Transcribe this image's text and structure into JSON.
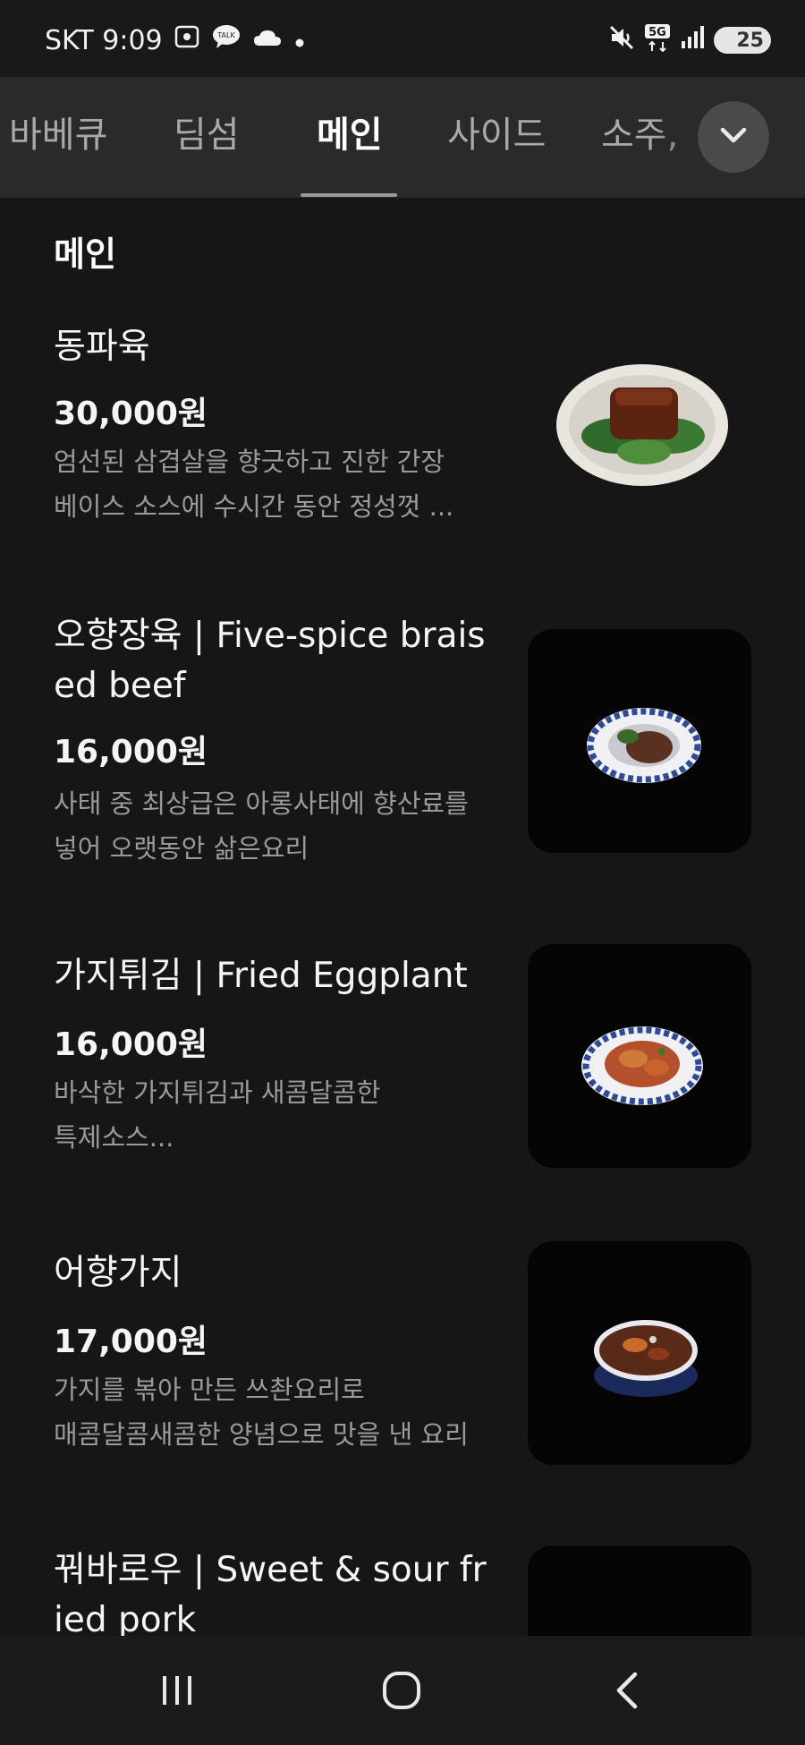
{
  "status": {
    "carrier_time": "SKT 9:09",
    "network": "5G",
    "battery": "25",
    "icons": [
      "screen-capture-icon",
      "talk-icon",
      "cloud-icon",
      "dot-icon",
      "mute-icon",
      "5g-icon",
      "signal-icon",
      "battery-icon"
    ]
  },
  "tabs": [
    {
      "label": "바베큐",
      "active": false
    },
    {
      "label": "딤섬",
      "active": false
    },
    {
      "label": "메인",
      "active": true
    },
    {
      "label": "사이드",
      "active": false
    },
    {
      "label": "소주,",
      "active": false
    }
  ],
  "section": {
    "title": "메인"
  },
  "items": [
    {
      "name": "동파육",
      "price": "30,000원",
      "desc_lines": [
        "엄선된 삼겹살을 향긋하고 진한 간장",
        "베이스 소스에 수시간 동안 정성껏 ..."
      ]
    },
    {
      "name": "오향장육 | Five-spice braised beef",
      "price": "16,000원",
      "desc_lines": [
        "사태 중 최상급은 아롱사태에 향산료를",
        "넣어 오랫동안 삶은요리"
      ]
    },
    {
      "name": "가지튀김 | Fried Eggplant",
      "price": "16,000원",
      "desc_lines": [
        "바삭한 가지튀김과 새콤달콤한",
        "특제소스..."
      ]
    },
    {
      "name": "어향가지",
      "price": "17,000원",
      "desc_lines": [
        "가지를 볶아 만든 쓰촨요리로",
        "매콤달콤새콤한 양념으로 맛을 낸 요리"
      ]
    },
    {
      "name": "꿔바로우 | Sweet & sour fried pork"
    }
  ],
  "nav": {
    "icons": [
      "recent-apps-icon",
      "home-icon",
      "back-icon"
    ]
  },
  "colors": {
    "background": "#161617",
    "tabbar": "#2a2a2b",
    "text_secondary": "#9a9a9c"
  }
}
